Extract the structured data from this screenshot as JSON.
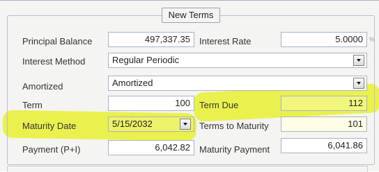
{
  "panel": {
    "title": "New Terms"
  },
  "fields": {
    "principal_balance": {
      "label": "Principal Balance",
      "value": "497,337.35"
    },
    "interest_rate": {
      "label": "Interest Rate",
      "value": "5.0000",
      "unit": "%"
    },
    "interest_method": {
      "label": "Interest Method",
      "value": "Regular Periodic"
    },
    "amortized": {
      "label": "Amortized",
      "value": "Amortized"
    },
    "term": {
      "label": "Term",
      "value": "100"
    },
    "term_due": {
      "label": "Term Due",
      "value": "112"
    },
    "maturity_date": {
      "label": "Maturity Date",
      "value": "5/15/2032"
    },
    "terms_to_maturity": {
      "label": "Terms to Maturity",
      "value": "101"
    },
    "payment": {
      "label": "Payment (P+I)",
      "value": "6,042.82"
    },
    "maturity_payment": {
      "label": "Maturity Payment",
      "value": "6,041.86"
    }
  },
  "colors": {
    "highlight": "#e8f02a",
    "field_border": "#a9b3c1",
    "readonly_bg": "#fffde6"
  }
}
